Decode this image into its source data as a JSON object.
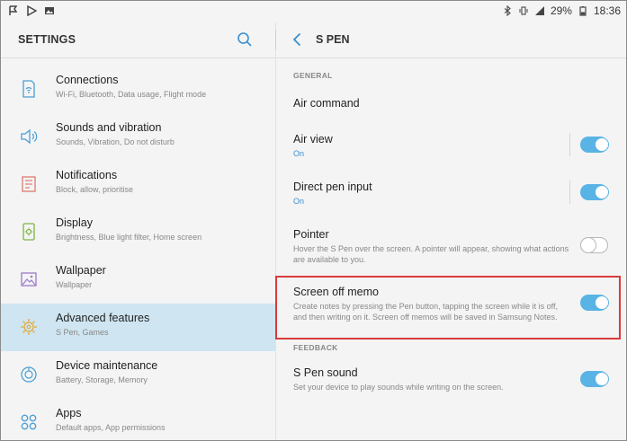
{
  "status_bar": {
    "battery": "29%",
    "time": "18:36"
  },
  "left_header": {
    "title": "SETTINGS"
  },
  "menu": [
    {
      "title": "Connections",
      "subtitle": "Wi-Fi, Bluetooth, Data usage, Flight mode",
      "icon": "connections-icon",
      "active": false
    },
    {
      "title": "Sounds and vibration",
      "subtitle": "Sounds, Vibration, Do not disturb",
      "icon": "sound-icon",
      "active": false
    },
    {
      "title": "Notifications",
      "subtitle": "Block, allow, prioritise",
      "icon": "notifications-icon",
      "active": false
    },
    {
      "title": "Display",
      "subtitle": "Brightness, Blue light filter, Home screen",
      "icon": "display-icon",
      "active": false
    },
    {
      "title": "Wallpaper",
      "subtitle": "Wallpaper",
      "icon": "wallpaper-icon",
      "active": false
    },
    {
      "title": "Advanced features",
      "subtitle": "S Pen, Games",
      "icon": "advanced-features-icon",
      "active": true
    },
    {
      "title": "Device maintenance",
      "subtitle": "Battery, Storage, Memory",
      "icon": "device-maintenance-icon",
      "active": false
    },
    {
      "title": "Apps",
      "subtitle": "Default apps, App permissions",
      "icon": "apps-icon",
      "active": false
    }
  ],
  "right_header": {
    "title": "S PEN"
  },
  "sections": {
    "general": "GENERAL",
    "feedback": "FEEDBACK"
  },
  "settings": {
    "air_command": {
      "title": "Air command"
    },
    "air_view": {
      "title": "Air view",
      "status": "On",
      "enabled": true
    },
    "direct_pen_input": {
      "title": "Direct pen input",
      "status": "On",
      "enabled": true
    },
    "pointer": {
      "title": "Pointer",
      "description": "Hover the S Pen over the screen. A pointer will appear, showing what actions are available to you.",
      "enabled": false
    },
    "screen_off_memo": {
      "title": "Screen off memo",
      "description": "Create notes by pressing the Pen button, tapping the screen while it is off, and then writing on it. Screen off memos will be saved in Samsung Notes.",
      "enabled": true
    },
    "s_pen_sound": {
      "title": "S Pen sound",
      "description": "Set your device to play sounds while writing on the screen.",
      "enabled": true
    }
  },
  "colors": {
    "accent": "#5ab3e5",
    "active_row": "#cfe5f1",
    "highlight_box": "#d93b3b",
    "icon_tint": "#4a9fd4"
  }
}
